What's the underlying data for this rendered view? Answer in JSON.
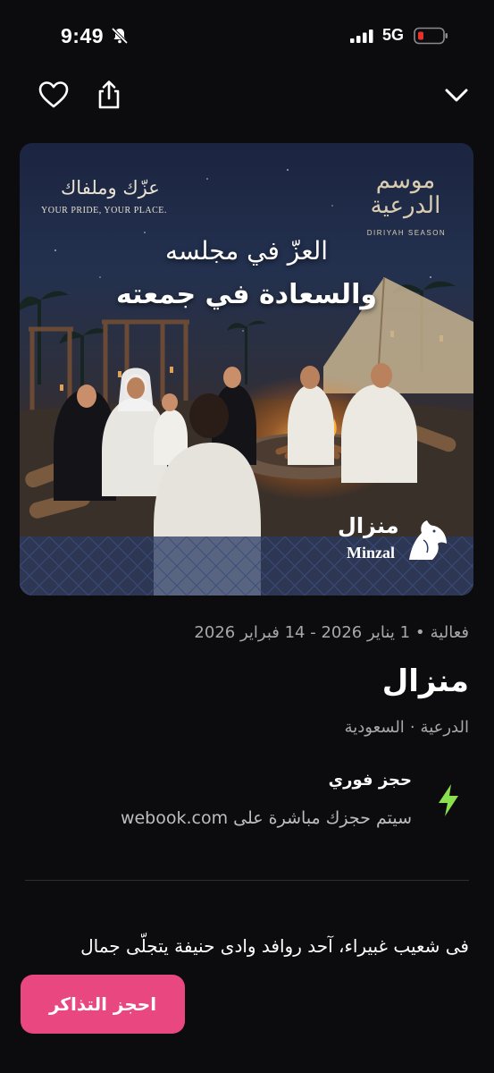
{
  "status_bar": {
    "time": "9:49",
    "network": "5G",
    "battery_color": "#e5322d",
    "icons": [
      "bell-slash-icon",
      "signal-icon",
      "battery-icon"
    ]
  },
  "nav": {
    "icons": [
      "heart-icon",
      "share-icon",
      "chevron-down-icon"
    ]
  },
  "hero": {
    "tagline_ar": "عزّك وملفاك",
    "tagline_en": "YOUR PRIDE, YOUR PLACE.",
    "season_logo_ar": "موسم الدرعية",
    "season_logo_en": "DIRIYAH SEASON",
    "headline_1": "العزّ في مجلسه",
    "headline_2": "والسعادة في جمعته",
    "brand_ar": "منزال",
    "brand_en": "Minzal"
  },
  "event": {
    "category": "فعالية",
    "dates": "1 يناير 2026 - 14 فبراير 2026",
    "title": "منزال",
    "location_area": "الدرعية",
    "location_country": "السعودية",
    "booking_type": "حجز فوري",
    "booking_desc": "سيتم حجزك مباشرة على webook.com",
    "description": "فى شعيب غبيراء، آحد روافد وادى حنيفة يتجلّى جمال"
  },
  "cta": {
    "book_label": "احجز التذاكر",
    "color": "#e9477f"
  },
  "colors": {
    "background": "#0c0c0e",
    "accent_bolt": "#8be04e",
    "muted_text": "#a7a7ac"
  }
}
